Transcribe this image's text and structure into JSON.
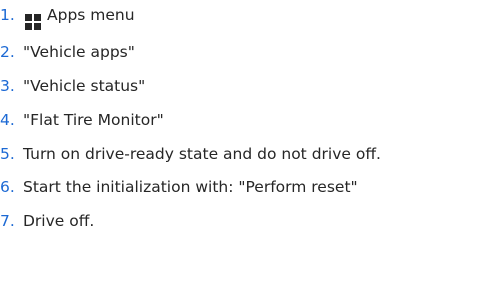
{
  "steps": [
    {
      "num": "1.",
      "icon": "apps-grid-icon",
      "text": "Apps menu"
    },
    {
      "num": "2.",
      "text": "\"Vehicle apps\""
    },
    {
      "num": "3.",
      "text": "\"Vehicle status\""
    },
    {
      "num": "4.",
      "text": "\"Flat Tire Monitor\""
    },
    {
      "num": "5.",
      "text": "Turn on drive-ready state and do not drive off."
    },
    {
      "num": "6.",
      "text": "Start the initialization with: \"Perform reset\""
    },
    {
      "num": "7.",
      "text": "Drive off."
    }
  ],
  "colors": {
    "number": "#1c69d4",
    "text": "#262626"
  }
}
